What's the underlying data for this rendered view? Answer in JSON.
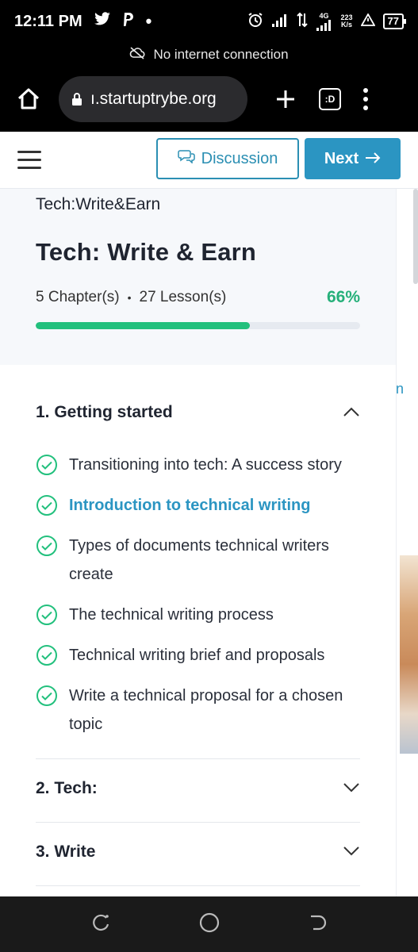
{
  "status_bar": {
    "time": "12:11 PM",
    "network_speed_value": "223",
    "network_speed_unit": "K/s",
    "network_type": "4G",
    "battery": "77"
  },
  "banner": {
    "text": "No internet connection"
  },
  "browser": {
    "url": "ı.startuptrybe.org",
    "tab_count": ":D"
  },
  "header": {
    "discussion_label": "Discussion",
    "next_label": "Next"
  },
  "course": {
    "breadcrumb": "Tech:Write&Earn",
    "title": "Tech: Write & Earn",
    "chapters_count": "5 Chapter(s)",
    "lessons_count": "27 Lesson(s)",
    "progress_label": "66%",
    "progress_value": 0.66
  },
  "chapters": [
    {
      "title": "1. Getting started",
      "expanded": true,
      "lessons": [
        {
          "title": "Transitioning into tech: A success story",
          "completed": true,
          "active": false
        },
        {
          "title": "Introduction to technical writing",
          "completed": true,
          "active": true
        },
        {
          "title": "Types of documents technical writers create",
          "completed": true,
          "active": false
        },
        {
          "title": "The technical writing process",
          "completed": true,
          "active": false
        },
        {
          "title": "Technical writing brief and proposals",
          "completed": true,
          "active": false
        },
        {
          "title": "Write a technical proposal for a chosen topic",
          "completed": true,
          "active": false
        }
      ]
    },
    {
      "title": "2. Tech:",
      "expanded": false
    },
    {
      "title": "3. Write",
      "expanded": false
    }
  ],
  "colors": {
    "accent": "#2b95c2",
    "success": "#22c07d",
    "panel_bg": "#f6f8fb"
  }
}
